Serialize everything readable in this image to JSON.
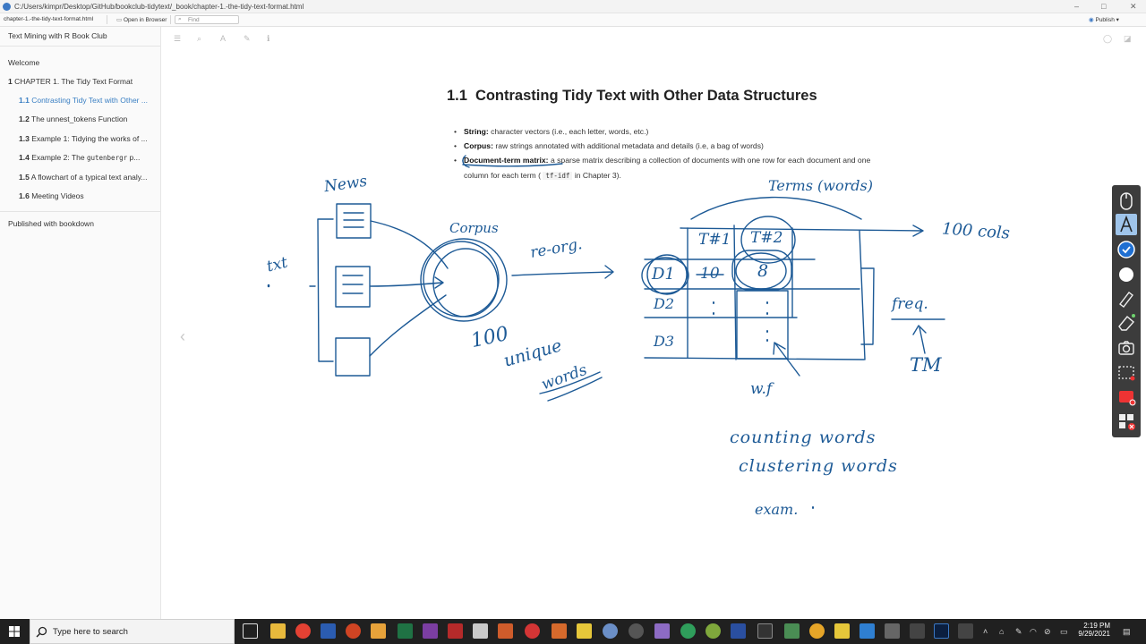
{
  "window": {
    "path": "C:/Users/kimpr/Desktop/GitHub/bookclub-tidytext/_book/chapter-1.-the-tidy-text-format.html"
  },
  "toolbar": {
    "tab_file": "chapter-1.-the-tidy-text-format.html",
    "open_in_browser": "Open in Browser",
    "find_placeholder": "Find",
    "publish": "Publish"
  },
  "sidebar": {
    "book_title": "Text Mining with R Book Club",
    "welcome": "Welcome",
    "chapter": {
      "num": "1",
      "label": "CHAPTER 1. The Tidy Text Format"
    },
    "sections": [
      {
        "num": "1.1",
        "label": "Contrasting Tidy Text with Other ..."
      },
      {
        "num": "1.2",
        "label": "The unnest_tokens Function"
      },
      {
        "num": "1.3",
        "label": "Example 1: Tidying the works of ..."
      },
      {
        "num": "1.4",
        "label_pre": "Example 2: The",
        "code": "gutenbergr",
        "label_post": "p..."
      },
      {
        "num": "1.5",
        "label": "A flowchart of a typical text analy..."
      },
      {
        "num": "1.6",
        "label": "Meeting Videos"
      }
    ],
    "published": "Published with bookdown"
  },
  "content": {
    "section_num": "1.1",
    "heading": "Contrasting Tidy Text with Other Data Structures",
    "bullets": [
      {
        "term": "String:",
        "text": "character vectors (i.e., each letter, words, etc.)"
      },
      {
        "term": "Corpus:",
        "text": "raw strings annotated with additional metadata and details (i.e, a bag of words)"
      },
      {
        "term": "Document-term matrix:",
        "text": "a sparse matrix describing a collection of documents with one row for each document and one column for each term (",
        "code": "tf-idf",
        "text_after": "in Chapter 3)."
      }
    ]
  },
  "annotations": {
    "news": "News",
    "txt": "txt",
    "corpus": "Corpus",
    "reorg": "re-org.",
    "hundred": "100",
    "unique": "unique",
    "words": "words",
    "terms": "Terms (words)",
    "hundred_cols": "100 cols",
    "t1": "T#1",
    "t2": "T#2",
    "d1": "D1",
    "d2": "D2",
    "d3": "D3",
    "ten": "10",
    "eight": "8",
    "freq": "freq.",
    "tm": "TM",
    "wf": "w.f",
    "counting": "counting words",
    "clustering": "clustering words",
    "exam": "exam."
  },
  "taskbar": {
    "search_placeholder": "Type here to search",
    "time": "2:19 PM",
    "date": "9/29/2021"
  },
  "colors": {
    "ink": "#1d5a96",
    "link_active": "#3a7fc3",
    "taskbar": "#202020"
  }
}
